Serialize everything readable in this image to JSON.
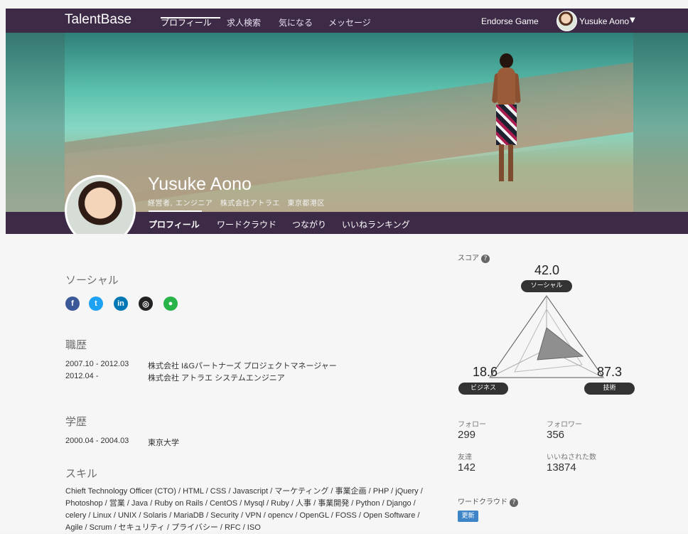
{
  "brand": "TalentBase",
  "topnav": {
    "items": [
      "プロフィール",
      "求人検索",
      "気になる",
      "メッセージ"
    ],
    "endorse": "Endorse Game",
    "user": "Yusuke Aono"
  },
  "profile": {
    "name": "Yusuke Aono",
    "subtitle": "経営者, エンジニア　株式会社アトラエ　東京都港区",
    "tabs": [
      "プロフィール",
      "ワードクラウド",
      "つながり",
      "いいねランキング"
    ]
  },
  "social": {
    "title": "ソーシャル",
    "icons": [
      "facebook-icon",
      "twitter-icon",
      "linkedin-icon",
      "github-icon",
      "talentbase-icon"
    ]
  },
  "career": {
    "title": "職歴",
    "rows": [
      {
        "period": "2007.10 - 2012.03",
        "text": "株式会社 I&Gパートナーズ プロジェクトマネージャー"
      },
      {
        "period": "2012.04 -",
        "text": "株式会社 アトラエ システムエンジニア"
      }
    ]
  },
  "education": {
    "title": "学歴",
    "period": "2000.04 - 2004.03",
    "school": "東京大学"
  },
  "skills": {
    "title": "スキル",
    "text": "Chieft Technology Officer (CTO) / HTML / CSS / Javascript / マーケティング / 事業企画 / PHP / jQuery / Photoshop / 営業 / Java / Ruby on Rails / CentOS / Mysql / Ruby / 人事 / 事業開発 / Python / Django / celery / Linux / UNIX / Solaris / MariaDB / Security / VPN / opencv / OpenGL / FOSS / Open Software / Agile / Scrum / セキュリティ / プライバシー / RFC / ISO"
  },
  "score": {
    "label": "スコア",
    "help": "?",
    "top_value": "42.0",
    "top_label": "ソーシャル",
    "left_value": "18.6",
    "left_label": "ビジネス",
    "right_value": "87.3",
    "right_label": "技術"
  },
  "stats": {
    "follow_label": "フォロー",
    "follow_value": "299",
    "follower_label": "フォロワー",
    "follower_value": "356",
    "friend_label": "友達",
    "friend_value": "142",
    "likes_label": "いいねされた数",
    "likes_value": "13874"
  },
  "wordcloud": {
    "label": "ワードクラウド",
    "help": "?",
    "button": "更新"
  }
}
